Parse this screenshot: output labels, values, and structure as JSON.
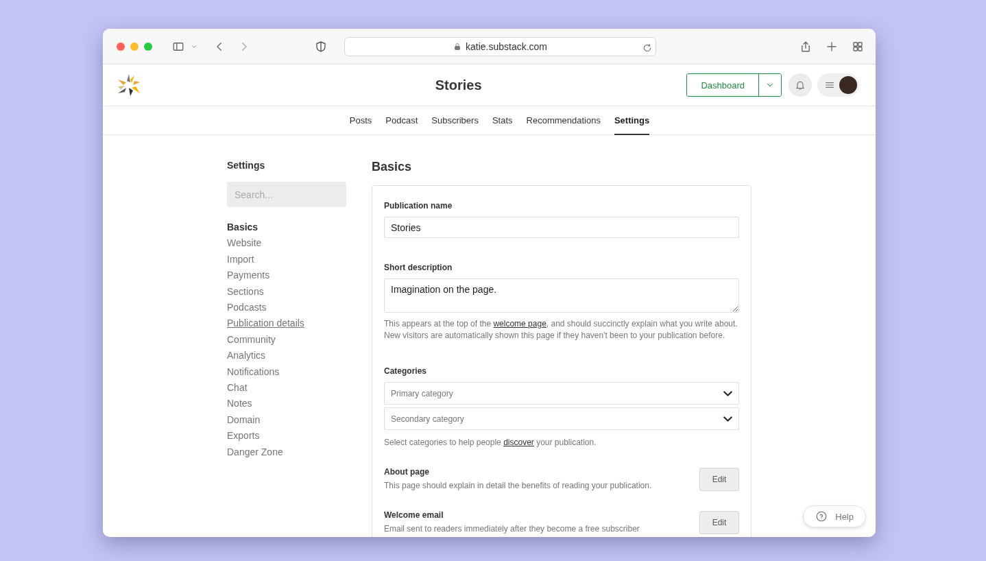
{
  "browser": {
    "url": "katie.substack.com"
  },
  "header": {
    "title": "Stories",
    "dashboard_button": "Dashboard"
  },
  "tabs": [
    {
      "label": "Posts",
      "selected": false
    },
    {
      "label": "Podcast",
      "selected": false
    },
    {
      "label": "Subscribers",
      "selected": false
    },
    {
      "label": "Stats",
      "selected": false
    },
    {
      "label": "Recommendations",
      "selected": false
    },
    {
      "label": "Settings",
      "selected": true
    }
  ],
  "sidebar": {
    "title": "Settings",
    "search": {
      "placeholder": "Search..."
    },
    "items": [
      {
        "label": "Basics",
        "selected": true,
        "hovered": false
      },
      {
        "label": "Website",
        "selected": false,
        "hovered": false
      },
      {
        "label": "Import",
        "selected": false,
        "hovered": false
      },
      {
        "label": "Payments",
        "selected": false,
        "hovered": false
      },
      {
        "label": "Sections",
        "selected": false,
        "hovered": false
      },
      {
        "label": "Podcasts",
        "selected": false,
        "hovered": false
      },
      {
        "label": "Publication details",
        "selected": false,
        "hovered": true
      },
      {
        "label": "Community",
        "selected": false,
        "hovered": false
      },
      {
        "label": "Analytics",
        "selected": false,
        "hovered": false
      },
      {
        "label": "Notifications",
        "selected": false,
        "hovered": false
      },
      {
        "label": "Chat",
        "selected": false,
        "hovered": false
      },
      {
        "label": "Notes",
        "selected": false,
        "hovered": false
      },
      {
        "label": "Domain",
        "selected": false,
        "hovered": false
      },
      {
        "label": "Exports",
        "selected": false,
        "hovered": false
      },
      {
        "label": "Danger Zone",
        "selected": false,
        "hovered": false
      }
    ]
  },
  "main": {
    "title": "Basics",
    "publication_name": {
      "label": "Publication name",
      "value": "Stories"
    },
    "short_description": {
      "label": "Short description",
      "value": "Imagination on the page.",
      "help_before": "This appears at the top of the ",
      "help_link": "welcome page",
      "help_after": ", and should succinctly explain what you write about. New visitors are automatically shown this page if they haven't been to your publication before."
    },
    "categories": {
      "label": "Categories",
      "selects": [
        {
          "placeholder": "Primary category"
        },
        {
          "placeholder": "Secondary category"
        }
      ],
      "help_before": "Select categories to help people ",
      "help_link": "discover",
      "help_after": " your publication."
    },
    "edit_rows": [
      {
        "title": "About page",
        "description": "This page should explain in detail the benefits of reading your publication.",
        "button": "Edit"
      },
      {
        "title": "Welcome email",
        "description": "Email sent to readers immediately after they become a free subscriber",
        "button": "Edit"
      }
    ]
  },
  "help_button": "Help"
}
